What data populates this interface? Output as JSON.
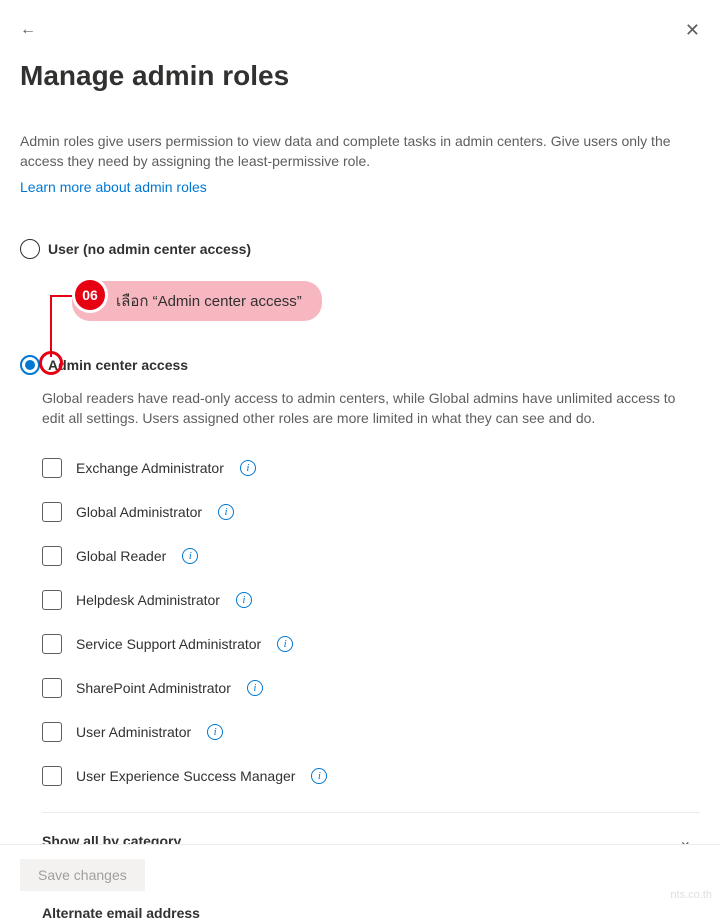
{
  "header": {
    "title": "Manage admin roles",
    "description": "Admin roles give users permission to view data and complete tasks in admin centers. Give users only the access they need by assigning the least-permissive role.",
    "link_text": "Learn more about admin roles"
  },
  "options": {
    "user_no_access": "User (no admin center access)",
    "admin_center_access": "Admin center access",
    "admin_description": "Global readers have read-only access to admin centers, while Global admins have unlimited access to edit all settings. Users assigned other roles are more limited in what they can see and do."
  },
  "annotation": {
    "step": "06",
    "text": "เลือก “Admin center access”"
  },
  "roles": [
    "Exchange Administrator",
    "Global Administrator",
    "Global Reader",
    "Helpdesk Administrator",
    "Service Support Administrator",
    "SharePoint Administrator",
    "User Administrator",
    "User Experience Success Manager"
  ],
  "expand": {
    "label": "Show all by category"
  },
  "sections": {
    "alternate_email": "Alternate email address"
  },
  "footer": {
    "save_label": "Save changes",
    "watermark": "nts.co.th"
  }
}
